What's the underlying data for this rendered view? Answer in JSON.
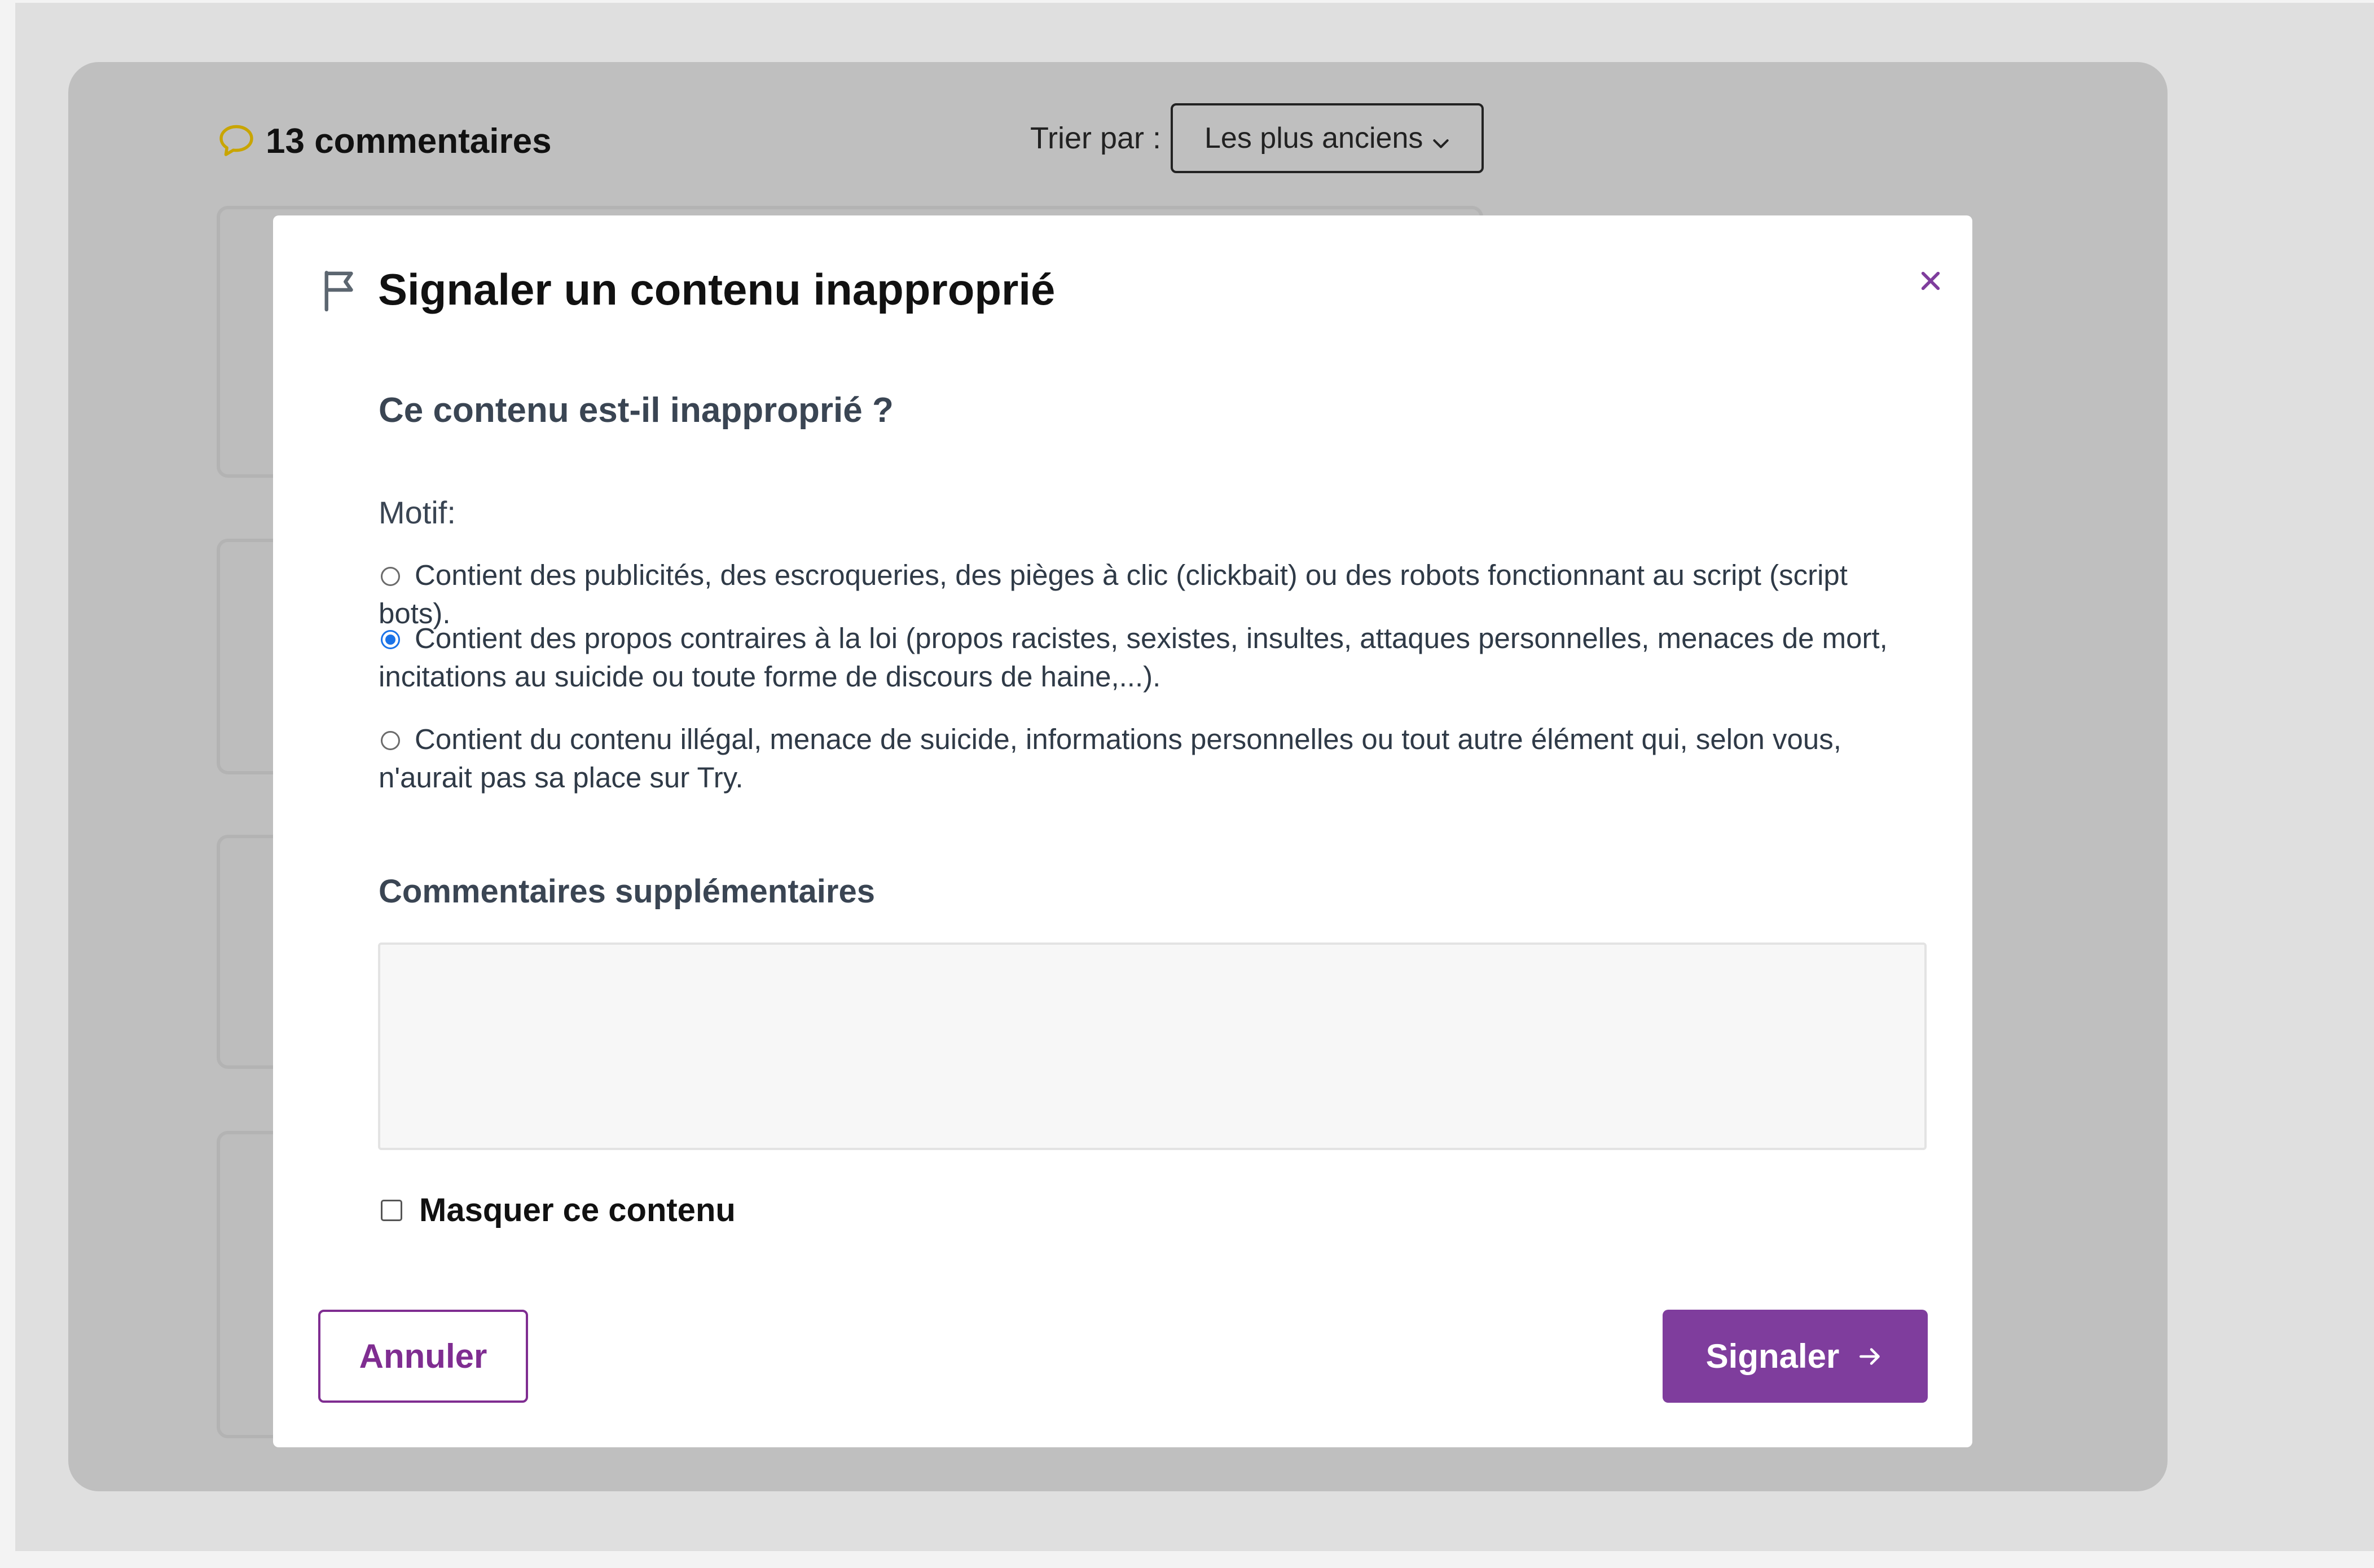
{
  "comments": {
    "count_label": "13 commentaires",
    "sort": {
      "label": "Trier par :",
      "selected": "Les plus anciens"
    }
  },
  "modal": {
    "title": "Signaler un contenu inapproprié",
    "question": "Ce contenu est-il inapproprié ?",
    "reason_label": "Motif:",
    "options": [
      {
        "label": "Contient des publicités, des escroqueries, des pièges à clic (clickbait) ou des robots fonctionnant au script (script bots).",
        "checked": false
      },
      {
        "label": "Contient des propos contraires à la loi (propos racistes, sexistes, insultes, attaques personnelles, menaces de mort, incitations au suicide ou toute forme de discours de haine,...).",
        "checked": true
      },
      {
        "label": "Contient du contenu illégal, menace de suicide, informations personnelles ou tout autre élément qui, selon vous, n'aurait pas sa place sur Try.",
        "checked": false
      }
    ],
    "extra_comments_label": "Commentaires supplémentaires",
    "extra_comments_value": "",
    "hide_label": "Masquer ce contenu",
    "cancel_label": "Annuler",
    "submit_label": "Signaler"
  },
  "colors": {
    "accent": "#7f3d9d",
    "radio_checked": "#1a73e8",
    "bubble_icon": "#c9a500"
  }
}
